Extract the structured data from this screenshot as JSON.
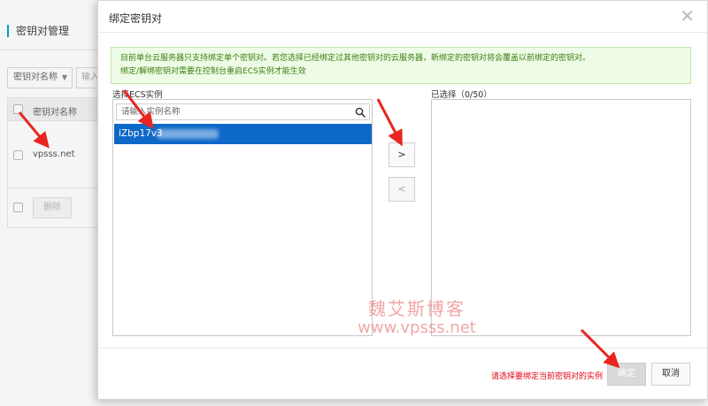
{
  "background": {
    "page_title": "密钥对管理",
    "filter_select": "密钥对名称",
    "search_placeholder": "输入",
    "table_header": "密钥对名称",
    "row_name": "vpsss.net",
    "delete_label": "删除"
  },
  "modal": {
    "title": "绑定密钥对",
    "notice_line1": "目前单台云服务器只支持绑定单个密钥对。若您选择已经绑定过其他密钥对的云服务器，新绑定的密钥对将会覆盖以前绑定的密钥对。",
    "notice_line2": "绑定/解绑密钥对需要在控制台重启ECS实例才能生效",
    "left_label": "选择ECS实例",
    "search_placeholder": "请输入实例名称",
    "instance_id": "iZbp17v3",
    "right_label": "已选择（0/50）",
    "add_label": ">",
    "remove_label": "<",
    "footer_hint": "请选择要绑定当前密钥对的实例",
    "confirm_label": "确定",
    "cancel_label": "取消"
  },
  "watermark": {
    "cn": "魏艾斯博客",
    "url": "www.vpsss.net"
  },
  "colors": {
    "accent": "#0e68c8",
    "notice_bg": "#eefbe6",
    "notice_text": "#3c7f10",
    "hint": "#e60012",
    "annotation": "#e8251f"
  }
}
